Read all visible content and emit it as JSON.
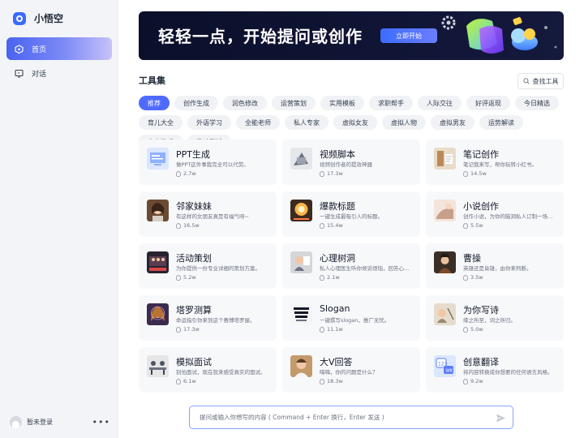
{
  "brand": {
    "name": "小悟空",
    "logo_icon": "app-logo-icon",
    "accent": "#3b6bff"
  },
  "nav": [
    {
      "label": "首页",
      "icon": "home-icon",
      "active": true
    },
    {
      "label": "对话",
      "icon": "chat-icon",
      "active": false
    }
  ],
  "user": {
    "label": "暂未登录",
    "more": "•••"
  },
  "banner": {
    "title": "轻轻一点，开始提问或创作",
    "button": "立即开始"
  },
  "tools": {
    "title": "工具集",
    "search_label": "查找工具",
    "chips": [
      "推荐",
      "创作生成",
      "润色修改",
      "运营策划",
      "实用模板",
      "求职帮手",
      "人际交往",
      "好评返现",
      "今日精选",
      "育儿大全",
      "外语学习",
      "全能老师",
      "私人专家",
      "虚拟女友",
      "虚拟人物",
      "虚拟男友",
      "运势解读",
      "文字游戏",
      "趣味测试"
    ],
    "active_chip": "推荐",
    "cards": [
      {
        "name": "PPT生成",
        "desc": "做PPT这件事我完全可以代劳。",
        "count": "2.7w",
        "thumb": "ppt"
      },
      {
        "name": "视频脚本",
        "desc": "视频创作者的提效神器",
        "count": "17.3w",
        "thumb": "video"
      },
      {
        "name": "笔记创作",
        "desc": "笔记我来写，帮你玩转小红书。",
        "count": "14.5w",
        "thumb": "note"
      },
      {
        "name": "邻家妹妹",
        "desc": "有这样的女朋友真是有福气呀~",
        "count": "16.5w",
        "thumb": "sister"
      },
      {
        "name": "爆款标题",
        "desc": "一键生成最吸引人的标题。",
        "count": "15.4w",
        "thumb": "title"
      },
      {
        "name": "小说创作",
        "desc": "创作小说，为你的脑洞私人订制一场盛宴",
        "count": "5.5w",
        "thumb": "novel"
      },
      {
        "name": "活动策划",
        "desc": "为你提供一份专业详细的策划方案。",
        "count": "5.2w",
        "thumb": "event"
      },
      {
        "name": "心理树洞",
        "desc": "私人心理医生听你倾诉烦恼，回答心理问题",
        "count": "2.1w",
        "thumb": "psych"
      },
      {
        "name": "曹操",
        "desc": "英雄还是枭雄，由你来判断。",
        "count": "3.5w",
        "thumb": "caocao"
      },
      {
        "name": "塔罗测算",
        "desc": "命运指引你来到这个赛博塔罗屋。",
        "count": "17.3w",
        "thumb": "tarot"
      },
      {
        "name": "Slogan",
        "desc": "一键撰写slogan，推广无忧。",
        "count": "11.1w",
        "thumb": "slogan"
      },
      {
        "name": "为你写诗",
        "desc": "缘之所至，词之所归。",
        "count": "5.0w",
        "thumb": "poem"
      },
      {
        "name": "模拟面试",
        "desc": "别怕面试，现在就来感受真实的面试。",
        "count": "6.1w",
        "thumb": "interview"
      },
      {
        "name": "大V回答",
        "desc": "嗨嗨，你的问题是什么？",
        "count": "18.3w",
        "thumb": "bigv"
      },
      {
        "name": "创意翻译",
        "desc": "将内容转换成你想要的任何语言风格。",
        "count": "9.2w",
        "thumb": "translate"
      }
    ]
  },
  "composer": {
    "placeholder": "提问或输入你想写的内容 ( Command + Enter 换行，Enter 发送 )",
    "send_icon": "send-icon"
  }
}
